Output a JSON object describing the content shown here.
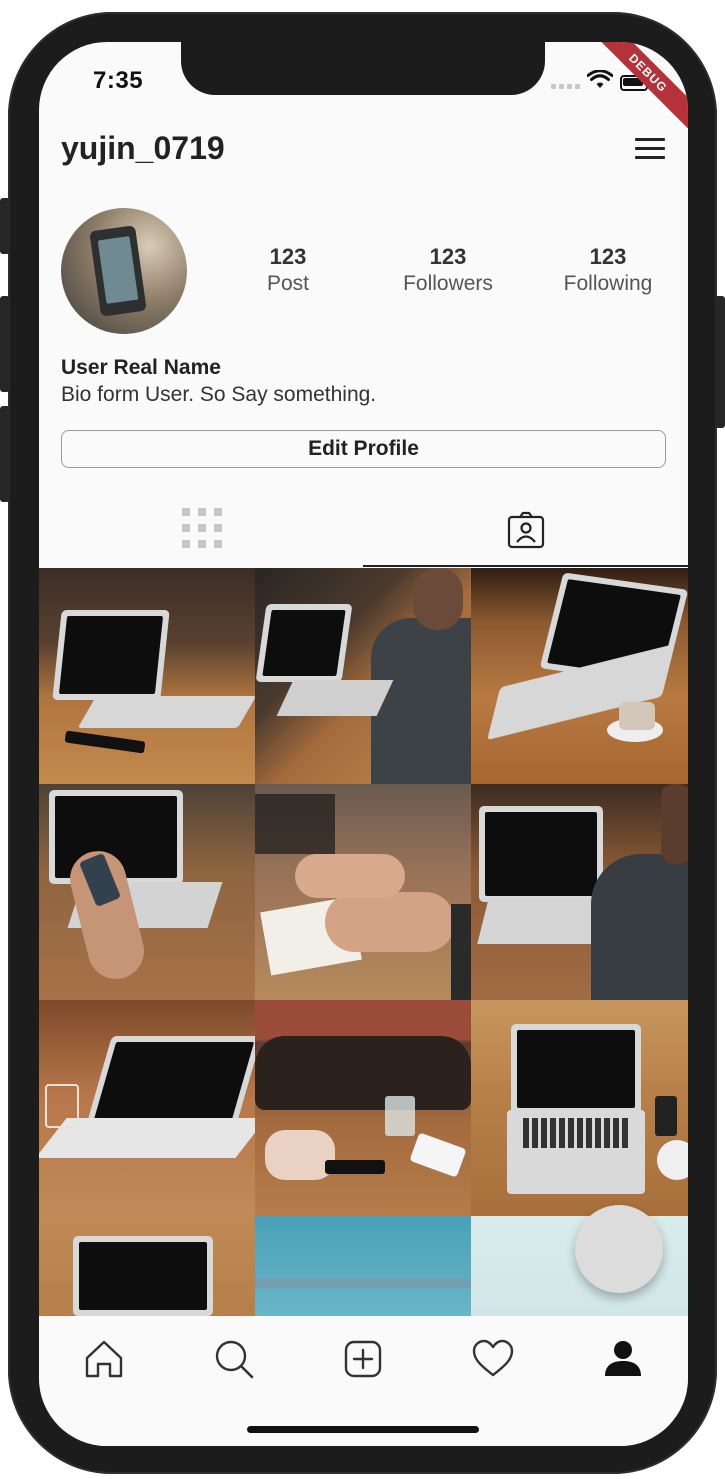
{
  "status_bar": {
    "time": "7:35",
    "debug_label": "DEBUG"
  },
  "header": {
    "username": "yujin_0719"
  },
  "profile": {
    "stats": [
      {
        "value": "123",
        "label": "Post"
      },
      {
        "value": "123",
        "label": "Followers"
      },
      {
        "value": "123",
        "label": "Following"
      }
    ],
    "real_name": "User Real Name",
    "bio": "Bio form User. So Say something.",
    "edit_button": "Edit Profile"
  },
  "tabs": {
    "items": [
      "grid-icon",
      "tagged-person-icon"
    ],
    "active": 1
  },
  "grid": {
    "photo_count": 12
  },
  "bottom_nav": {
    "items": [
      "home-icon",
      "search-icon",
      "add-icon",
      "heart-icon",
      "profile-icon"
    ],
    "active": 4
  },
  "colors": {
    "background": "#fafafa",
    "text": "#222222",
    "muted": "#c8c8c8",
    "debug_ribbon": "#b5323b"
  }
}
